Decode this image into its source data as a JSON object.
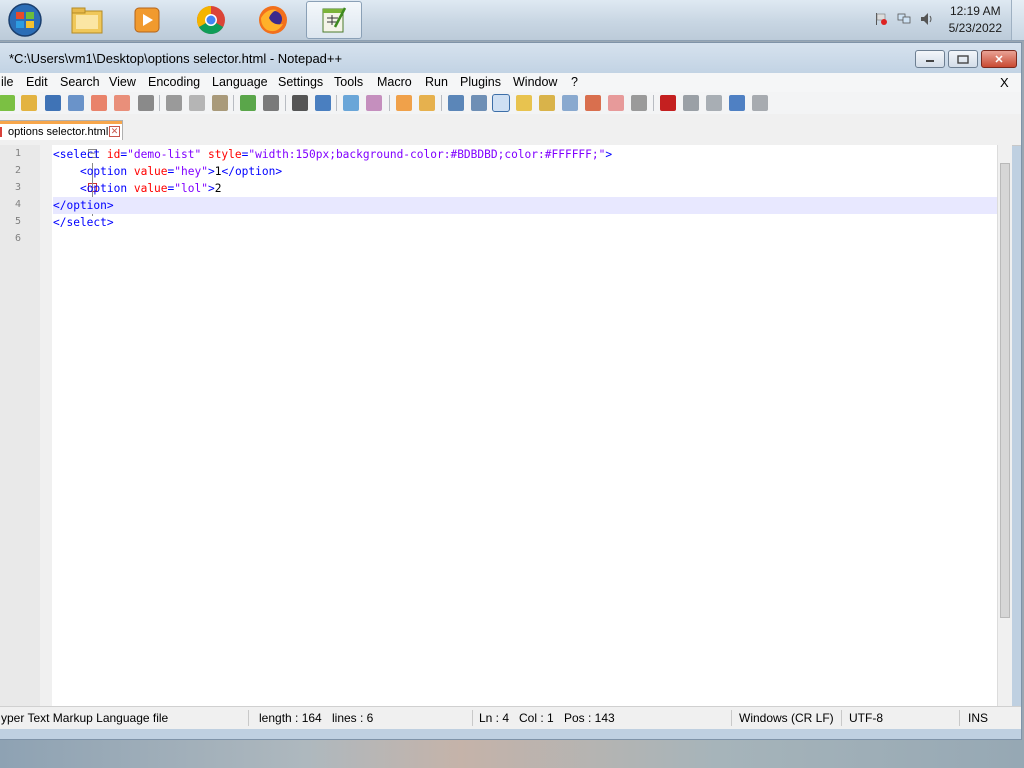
{
  "taskbar": {
    "icons": [
      "windows-start-icon",
      "file-explorer-icon",
      "media-player-icon",
      "chrome-icon",
      "firefox-icon",
      "notepad-plus-plus-icon"
    ],
    "clock_time": "12:19 AM",
    "clock_date": "5/23/2022"
  },
  "window": {
    "title": "*C:\\Users\\vm1\\Desktop\\options selector.html - Notepad++",
    "close_glyph": "✕"
  },
  "menubar": {
    "items": [
      "ile",
      "Edit",
      "Search",
      "View",
      "Encoding",
      "Language",
      "Settings",
      "Tools",
      "Macro",
      "Run",
      "Plugins",
      "Window",
      "?"
    ],
    "close_x": "X"
  },
  "tab": {
    "label": "options selector.html",
    "close_glyph": "✕"
  },
  "editor": {
    "line_numbers": [
      "1",
      "2",
      "3",
      "4",
      "5",
      "6"
    ],
    "lines": [
      "<select id=\"demo-list\" style=\"width:150px;background-color:#BDBDBD;color:#FFFFFF;\">",
      "    <option value=\"hey\">1</option>",
      "    <option value=\"lol\">2",
      "</option>",
      "</select>",
      ""
    ]
  },
  "statusbar": {
    "file_type": "yper Text Markup Language file",
    "length": "length : 164",
    "lines": "lines : 6",
    "ln": "Ln : 4",
    "col": "Col : 1",
    "pos": "Pos : 143",
    "eol": "Windows (CR LF)",
    "encoding": "UTF-8",
    "mode": "INS"
  }
}
